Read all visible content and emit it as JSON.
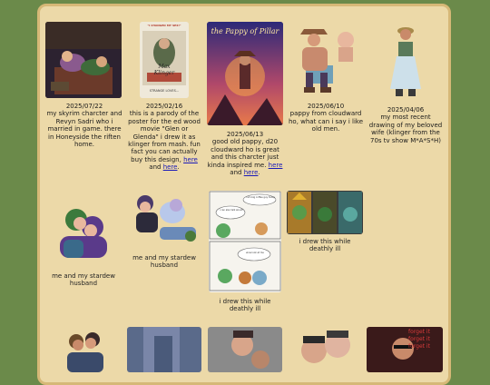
{
  "gallery": {
    "entries": [
      {
        "date": "2025/07/22",
        "text": "my skyrim charcter and Revyn Sadri who i married in game. there in Honeyside the riften home."
      },
      {
        "date": "2025/02/16",
        "text": "this is a parody of the poster for the ed wood movie \"Glen or Glenda\" i drew it as klinger from mash. fun fact you can actually buy this design,",
        "link1": "here",
        "and": "and",
        "link2": "here",
        "end": "."
      },
      {
        "date": "2025/06/13",
        "text": "good old pappy, d20 cloudward ho is great and this charcter just kinda inspired me.",
        "link1": "here",
        "and": "and",
        "link2": "here",
        "end": "."
      },
      {
        "date": "2025/06/10",
        "text": "pappy from cloudward ho, what can i say i like old men."
      },
      {
        "date": "2025/04/06",
        "text": "my most recent drawing of my beloved wife (klinger from the 70s tv show M*A*S*H)"
      }
    ],
    "row2": [
      {
        "text": "me and my stardew husband"
      },
      {
        "text": "me and my stardew husband"
      },
      {
        "text": "i drew this while deathly ill"
      },
      {
        "text": "i drew this while deathly ill"
      }
    ],
    "poster_title": "\"I CHANGED MY SEX!\"",
    "poster_line1": "Max",
    "poster_line2": "Klinger",
    "poster_sub": "STRANGE LOVES...",
    "pappy_title": "the Pappy of Pillar",
    "comic_bubble1": "i am big coffee guy today",
    "comic_bubble2": "i can also talk aloud!",
    "comic_bubble3": "wow look at me",
    "forget_text": "forget it"
  },
  "colors": {
    "page_bg": "#6b8a4a",
    "panel_bg": "#ecd9a8",
    "panel_border": "#d6b877",
    "link": "#1a1ab8"
  }
}
